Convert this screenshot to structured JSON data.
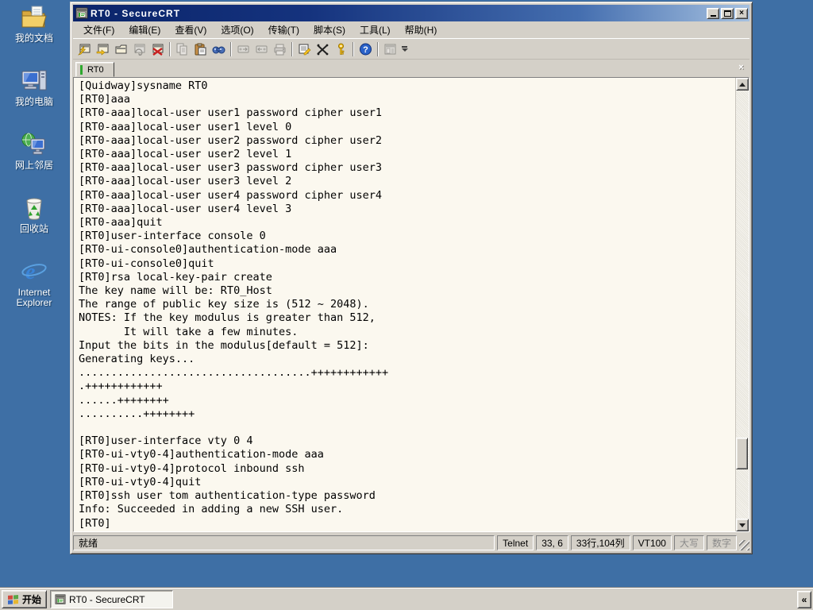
{
  "colors": {
    "desktop_bg": "#3E6FA5",
    "chrome": "#D4D0C8",
    "title_gradient_left": "#0A246A",
    "title_gradient_right": "#A6C1E0",
    "terminal_bg": "#FBF8EF",
    "terminal_text": "#000000",
    "tab_connected_indicator": "#2EA82E",
    "disabled_text": "#8A8A8A"
  },
  "desktop": {
    "icons": [
      {
        "name": "my-documents",
        "label": "我的文档"
      },
      {
        "name": "my-computer",
        "label": "我的电脑"
      },
      {
        "name": "network-places",
        "label": "网上邻居"
      },
      {
        "name": "recycle-bin",
        "label": "回收站"
      },
      {
        "name": "internet-explorer",
        "label": "Internet Explorer"
      }
    ]
  },
  "window": {
    "title": "RT0 - SecureCRT",
    "controls": {
      "minimize": "minimize",
      "maximize": "maximize",
      "close": "×"
    },
    "menu": [
      "文件(F)",
      "编辑(E)",
      "查看(V)",
      "选项(O)",
      "传输(T)",
      "脚本(S)",
      "工具(L)",
      "帮助(H)"
    ],
    "toolbar_icons": [
      "quick-connect-icon",
      "connect-icon",
      "connect-in-tab-icon",
      "reconnect-icon",
      "disconnect-icon",
      "copy-icon",
      "paste-icon",
      "find-icon",
      "send-file-icon",
      "receive-file-icon",
      "print-icon",
      "session-options-icon",
      "keymap-icon",
      "key-icon",
      "help-icon",
      "session-manager-icon",
      "toolbar-overflow-icon"
    ],
    "tab": {
      "label": "RT0",
      "close": "×"
    },
    "terminal": {
      "lines": [
        "[Quidway]sysname RT0",
        "[RT0]aaa",
        "[RT0-aaa]local-user user1 password cipher user1",
        "[RT0-aaa]local-user user1 level 0",
        "[RT0-aaa]local-user user2 password cipher user2",
        "[RT0-aaa]local-user user2 level 1",
        "[RT0-aaa]local-user user3 password cipher user3",
        "[RT0-aaa]local-user user3 level 2",
        "[RT0-aaa]local-user user4 password cipher user4",
        "[RT0-aaa]local-user user4 level 3",
        "[RT0-aaa]quit",
        "[RT0]user-interface console 0",
        "[RT0-ui-console0]authentication-mode aaa",
        "[RT0-ui-console0]quit",
        "[RT0]rsa local-key-pair create",
        "The key name will be: RT0_Host",
        "The range of public key size is (512 ~ 2048).",
        "NOTES: If the key modulus is greater than 512,",
        "       It will take a few minutes.",
        "Input the bits in the modulus[default = 512]:",
        "Generating keys...",
        "....................................++++++++++++",
        ".++++++++++++",
        "......++++++++",
        "..........++++++++",
        "",
        "[RT0]user-interface vty 0 4",
        "[RT0-ui-vty0-4]authentication-mode aaa",
        "[RT0-ui-vty0-4]protocol inbound ssh",
        "[RT0-ui-vty0-4]quit",
        "[RT0]ssh user tom authentication-type password",
        "Info: Succeeded in adding a new SSH user.",
        "[RT0]"
      ]
    },
    "statusbar": {
      "ready": "就绪",
      "protocol": "Telnet",
      "cursor_pos": "33,  6",
      "grid_size": "33行,104列",
      "emulation": "VT100",
      "caps": "大写",
      "num": "数字"
    }
  },
  "taskbar": {
    "start": "开始",
    "task": "RT0 - SecureCRT",
    "collapse": "«"
  }
}
